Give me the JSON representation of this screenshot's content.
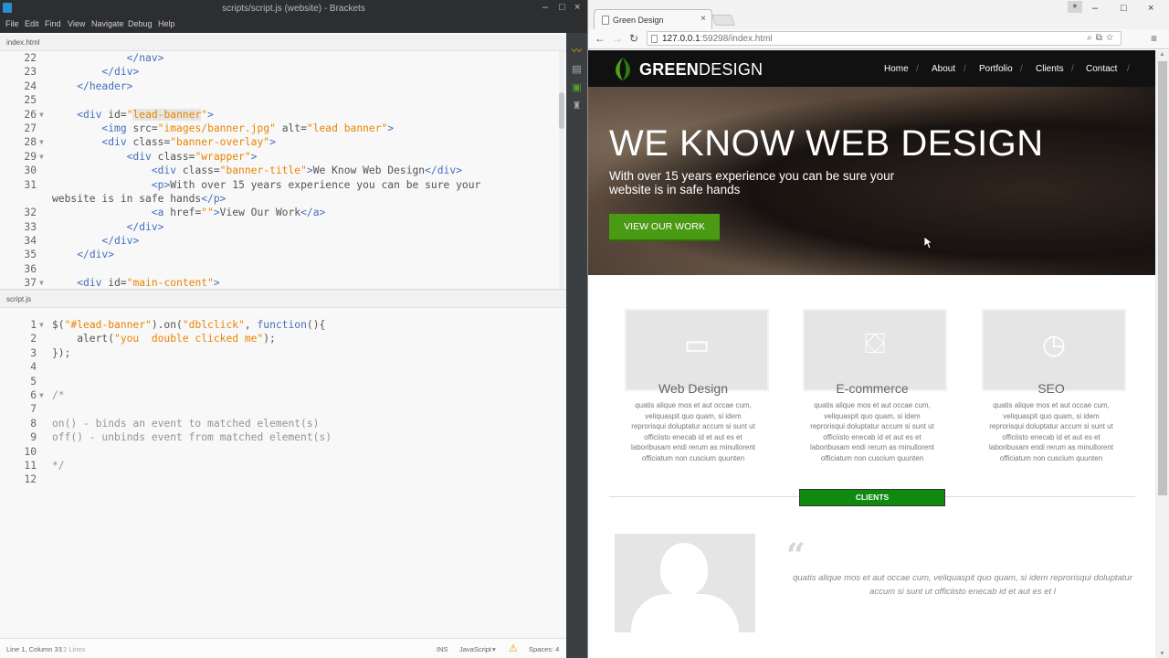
{
  "brackets": {
    "window_title": "scripts/script.js (website) - Brackets",
    "menu": [
      "File",
      "Edit",
      "Find",
      "View",
      "Navigate",
      "Debug",
      "Help"
    ],
    "top_file": "index.html",
    "bottom_file": "script.js",
    "status": {
      "cursor": "Line 1, Column 31",
      "lines": "12 Lines",
      "mode": "INS",
      "language": "JavaScript",
      "spaces": "Spaces: 4"
    },
    "html_lines": [
      {
        "n": "22",
        "fold": "",
        "code": "            </nav>"
      },
      {
        "n": "23",
        "fold": "",
        "code": "        </div>"
      },
      {
        "n": "24",
        "fold": "",
        "code": "    </header>"
      },
      {
        "n": "25",
        "fold": "",
        "code": ""
      },
      {
        "n": "26",
        "fold": "▼",
        "code": "    <div id=\"lead-banner\">"
      },
      {
        "n": "27",
        "fold": "",
        "code": "        <img src=\"images/banner.jpg\" alt=\"lead banner\">"
      },
      {
        "n": "28",
        "fold": "▼",
        "code": "        <div class=\"banner-overlay\">"
      },
      {
        "n": "29",
        "fold": "▼",
        "code": "            <div class=\"wrapper\">"
      },
      {
        "n": "30",
        "fold": "",
        "code": "                <div class=\"banner-title\">We Know Web Design</div>"
      },
      {
        "n": "31",
        "fold": "",
        "code": "                <p>With over 15 years experience you can be sure your"
      },
      {
        "n": "",
        "fold": "",
        "code": "website is in safe hands</p>"
      },
      {
        "n": "32",
        "fold": "",
        "code": "                <a href=\"\">View Our Work</a>"
      },
      {
        "n": "33",
        "fold": "",
        "code": "            </div>"
      },
      {
        "n": "34",
        "fold": "",
        "code": "        </div>"
      },
      {
        "n": "35",
        "fold": "",
        "code": "    </div>"
      },
      {
        "n": "36",
        "fold": "",
        "code": ""
      },
      {
        "n": "37",
        "fold": "▼",
        "code": "    <div id=\"main-content\">"
      }
    ],
    "js_lines": [
      {
        "n": "1",
        "fold": "▼",
        "code": "$(\"#lead-banner\").on(\"dblclick\", function(){"
      },
      {
        "n": "2",
        "fold": "",
        "code": "    alert(\"you  double clicked me\");"
      },
      {
        "n": "3",
        "fold": "",
        "code": "});"
      },
      {
        "n": "4",
        "fold": "",
        "code": ""
      },
      {
        "n": "5",
        "fold": "",
        "code": ""
      },
      {
        "n": "6",
        "fold": "▼",
        "code": "/*"
      },
      {
        "n": "7",
        "fold": "",
        "code": ""
      },
      {
        "n": "8",
        "fold": "",
        "code": "on() - binds an event to matched element(s)"
      },
      {
        "n": "9",
        "fold": "",
        "code": "off() - unbinds event from matched element(s)"
      },
      {
        "n": "10",
        "fold": "",
        "code": ""
      },
      {
        "n": "11",
        "fold": "",
        "code": "*/"
      },
      {
        "n": "12",
        "fold": "",
        "code": ""
      }
    ]
  },
  "browser": {
    "tab_title": "Green Design",
    "url_host": "127.0.0.1",
    "url_rest": ":59298/index.html",
    "site": {
      "logo_bold": "GREEN",
      "logo_light": "DESIGN",
      "nav": [
        "Home",
        "About",
        "Portfolio",
        "Clients",
        "Contact"
      ],
      "banner_title": "WE KNOW WEB DESIGN",
      "banner_text": "With over 15 years experience you can be sure your website is in safe hands",
      "banner_button": "VIEW OUR WORK",
      "features": [
        {
          "title": "Web Design",
          "icon": "monitor-icon",
          "glyph": "▭",
          "text": "quatis alique mos et aut occae cum, veliquaspit quo quam, si idem reprorisqui doluptatur accum si sunt ut officiisto enecab id et aut es et laboribusam endi rerum as minullorent officiatum non cuscium quunten"
        },
        {
          "title": "E-commerce",
          "icon": "basket-icon",
          "glyph": "⛋",
          "text": "quatis alique mos et aut occae cum, veliquaspit quo quam, si idem reprorisqui doluptatur accum si sunt ut officiisto enecab id et aut es et laboribusam endi rerum as minullorent officiatum non cuscium quunten"
        },
        {
          "title": "SEO",
          "icon": "clock-icon",
          "glyph": "◷",
          "text": "quatis alique mos et aut occae cum, veliquaspit quo quam, si idem reprorisqui doluptatur accum si sunt ut officiisto enecab id et aut es et laboribusam endi rerum as minullorent officiatum non cuscium quunten"
        }
      ],
      "clients_label": "CLIENTS",
      "quote_mark": "“",
      "quote_text": "quatis alique mos et aut occae cum, veliquaspit quo quam, si idem reprorisqui doluptatur accum si sunt ut officiisto enecab id et aut es et l"
    }
  },
  "colors": {
    "brand_green": "#4a9a14",
    "clients_green": "#0f8a0f",
    "code_tag": "#446fbd",
    "code_string": "#e88501",
    "code_comment": "#949494"
  }
}
